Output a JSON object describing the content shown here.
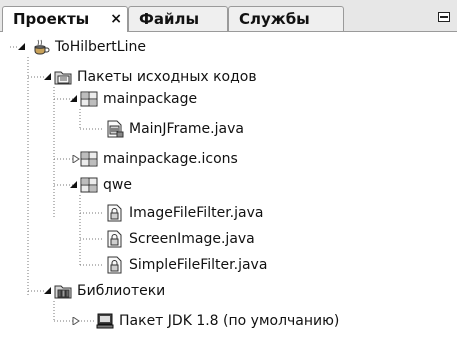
{
  "tabs": [
    {
      "label": "Проекты",
      "close": "×",
      "active": true
    },
    {
      "label": "Файлы",
      "active": false
    },
    {
      "label": "Службы",
      "active": false
    }
  ],
  "tree": [
    {
      "label": "ToHilbertLine",
      "icon": "project-icon",
      "expanded": true
    },
    {
      "label": "Пакеты исходных кодов",
      "icon": "source-folder-icon",
      "expanded": true
    },
    {
      "label": "mainpackage",
      "icon": "package-icon",
      "expanded": true
    },
    {
      "label": "MainJFrame.java",
      "icon": "form-file-icon"
    },
    {
      "label": "mainpackage.icons",
      "icon": "package-icon",
      "expanded": false
    },
    {
      "label": "qwe",
      "icon": "package-icon",
      "expanded": true
    },
    {
      "label": "ImageFileFilter.java",
      "icon": "java-class-icon"
    },
    {
      "label": "ScreenImage.java",
      "icon": "java-class-icon"
    },
    {
      "label": "SimpleFileFilter.java",
      "icon": "java-class-icon"
    },
    {
      "label": "Библиотеки",
      "icon": "library-folder-icon",
      "expanded": true
    },
    {
      "label": "Пакет JDK 1.8 (по умолчанию)",
      "icon": "jdk-icon",
      "expanded": false
    }
  ]
}
